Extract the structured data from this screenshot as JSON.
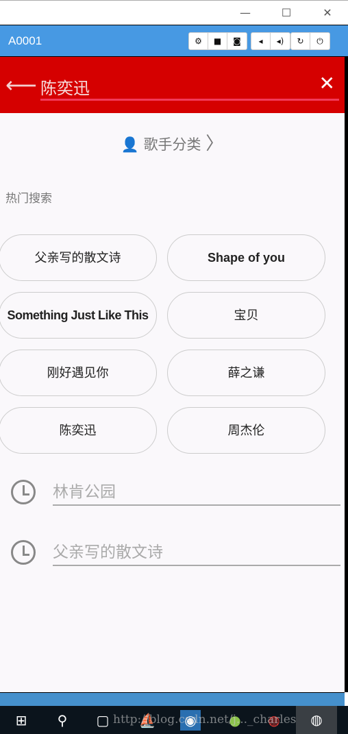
{
  "window": {
    "minimize": "—",
    "maximize": "☐",
    "close": "✕"
  },
  "emulator": {
    "title": "A0001",
    "icons": [
      "gear-icon",
      "video-icon",
      "camera-icon",
      "volume-down-icon",
      "volume-up-icon",
      "rotate-icon",
      "power-icon"
    ]
  },
  "search": {
    "query": "陈奕迅",
    "accent": "#d50000"
  },
  "singer_category": "歌手分类",
  "hot_title": "热门搜索",
  "hot_tags": [
    "父亲写的散文诗",
    "Shape of you",
    "Something Just Like This",
    "宝贝",
    "刚好遇见你",
    "薛之谦",
    "陈奕迅",
    "周杰伦"
  ],
  "history": [
    "林肯公园",
    "父亲写的散文诗"
  ],
  "watermark": "http://blog.csdn.net/j..._charles"
}
